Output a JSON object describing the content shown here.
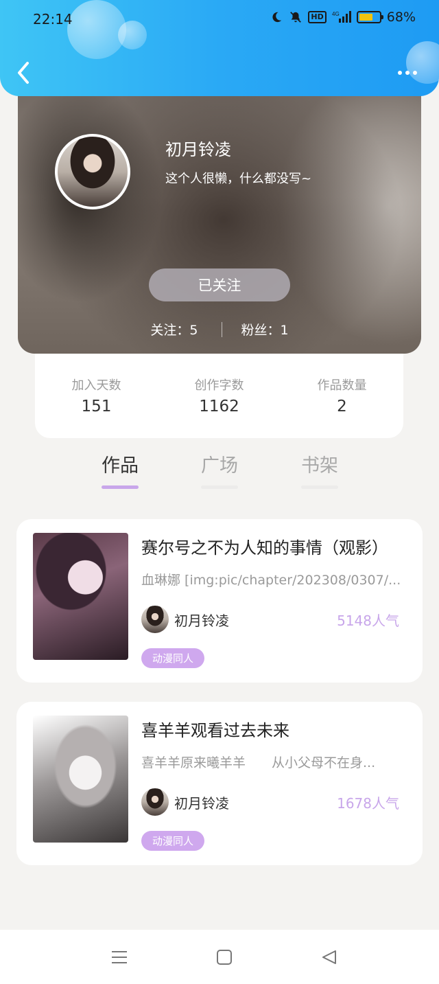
{
  "status_bar": {
    "time": "22:14",
    "hd": "HD",
    "network": "4G",
    "battery_percent": "68%",
    "battery_level": 0.68
  },
  "header": {
    "back_icon": "chevron-left-icon",
    "more_icon": "more-dots-icon",
    "color_start": "#3fc5f5",
    "color_end": "#1e9bf3"
  },
  "profile": {
    "username": "初月铃凌",
    "bio": "这个人很懒，什么都没写~",
    "follow_button": "已关注",
    "following": "关注：5",
    "followers": "粉丝：1"
  },
  "stats": [
    {
      "label": "加入天数",
      "value": "151"
    },
    {
      "label": "创作字数",
      "value": "1162"
    },
    {
      "label": "作品数量",
      "value": "2"
    }
  ],
  "tabs": [
    {
      "label": "作品",
      "active": true
    },
    {
      "label": "广场",
      "active": false
    },
    {
      "label": "书架",
      "active": false
    }
  ],
  "works": [
    {
      "title": "赛尔号之不为人知的事情（观影）",
      "description": "血琳娜 [img:pic/chapter/202308/0307/...",
      "author": "初月铃凌",
      "popularity": "5148人气",
      "tag": "动漫同人"
    },
    {
      "title": "喜羊羊观看过去未来",
      "description": "喜羊羊原来曦羊羊　　从小父母不在身...",
      "author": "初月铃凌",
      "popularity": "1678人气",
      "tag": "动漫同人"
    }
  ],
  "accent_color": "#c8a6ea"
}
